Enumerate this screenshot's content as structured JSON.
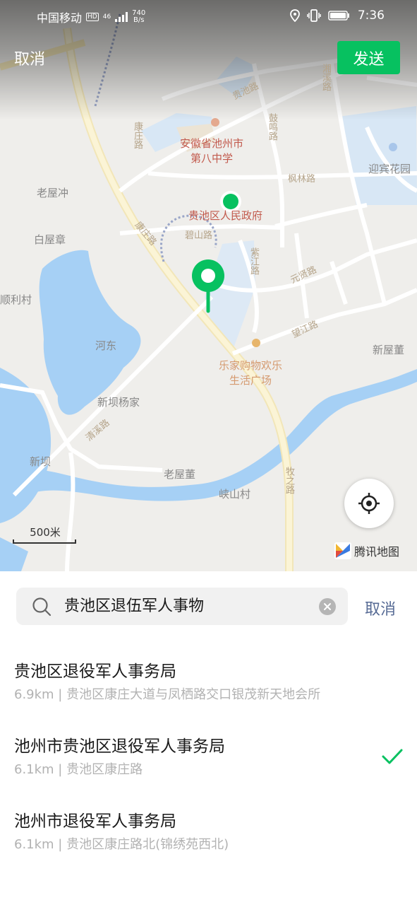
{
  "status_bar": {
    "carrier": "中国移动",
    "hd": "HD",
    "signal": "46",
    "speed_value": "740",
    "speed_unit": "B/s",
    "time": "7:36",
    "icons": [
      "location-icon",
      "vibrate-icon",
      "battery-icon"
    ]
  },
  "top_bar": {
    "cancel_label": "取消",
    "send_label": "发送",
    "accent_color": "#07c160"
  },
  "map": {
    "labels": {
      "school": "安徽省池州市\n第八中学",
      "yingbin": "迎宾花园",
      "laowuchong": "老屋冲",
      "baiwuzhang": "白屋章",
      "shunli": "顺利村",
      "gov": "贵池区人民政府",
      "hedong": "河东",
      "xinwudong": "新屋董",
      "mall": "乐家购物欢乐\n生活广场",
      "xinba": "新坝杨家",
      "xinba2": "新坝",
      "laowudong": "老屋董",
      "xiashan": "峡山村",
      "road_kangzhuang": "康庄路",
      "road_kangzhuang2": "康庄路",
      "road_guichi": "贵池路",
      "road_fenglin": "枫林路",
      "road_bishan": "碧山路",
      "road_zijiang": "紫江路",
      "road_yuanxian": "元贤路",
      "road_wangjiang": "望江路",
      "road_gulu": "鼓鸣路",
      "road_mushan": "牧之路",
      "road_qingxi": "清溪路",
      "road_xiangxian": "湘溪路"
    },
    "scale_label": "500米",
    "provider_label": "腾讯地图"
  },
  "search": {
    "query": "贵池区退伍军人事物",
    "cancel_label": "取消"
  },
  "results": [
    {
      "name": "贵池区退役军人事务局",
      "detail": "6.9km | 贵池区康庄大道与凤栖路交口银茂新天地会所",
      "selected": false
    },
    {
      "name": "池州市贵池区退役军人事务局",
      "detail": "6.1km | 贵池区康庄路",
      "selected": true
    },
    {
      "name": "池州市退役军人事务局",
      "detail": "6.1km | 贵池区康庄路北(锦绣苑西北)",
      "selected": false
    }
  ]
}
